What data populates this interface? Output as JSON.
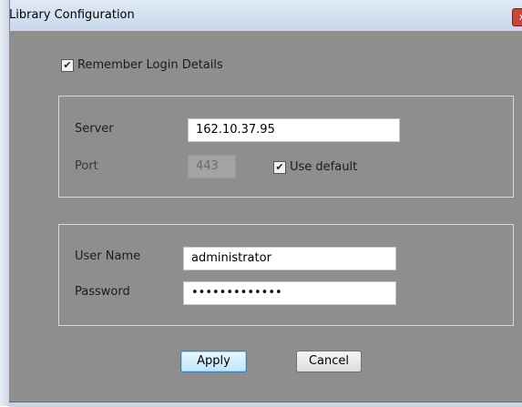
{
  "window": {
    "title": "Library Configuration",
    "close_glyph": "x"
  },
  "remember": {
    "label": "Remember Login Details",
    "checked": true,
    "check_glyph": "✔"
  },
  "connection": {
    "server_label": "Server",
    "server_value": "162.10.37.95",
    "port_label": "Port",
    "port_value": "443",
    "use_default_label": "Use default",
    "use_default_checked": true
  },
  "credentials": {
    "username_label": "User Name",
    "username_value": "administrator",
    "password_label": "Password",
    "password_masked": "•••••••••••••"
  },
  "buttons": {
    "apply_label": "Apply",
    "cancel_label": "Cancel"
  }
}
